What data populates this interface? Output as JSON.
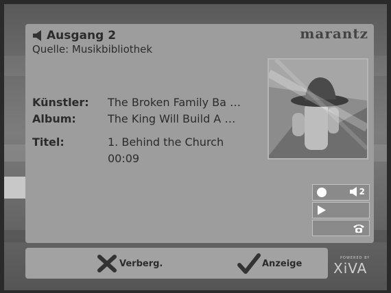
{
  "header": {
    "output_title": "Ausgang 2",
    "source_line": "Quelle: Musikbibliothek",
    "brand": "marantz"
  },
  "track": {
    "artist_label": "Künstler:",
    "artist_value": "The Broken Family Ba …",
    "album_label": "Album:",
    "album_value": "The King Will Build A …",
    "title_label": "Titel:",
    "title_value": "1. Behind the Church",
    "elapsed": "00:09"
  },
  "controls": {
    "volume_zone": "2",
    "icons": [
      "record-icon",
      "speaker-icon",
      "play-icon",
      "telephone-icon"
    ]
  },
  "bottom": {
    "hide_label": "Verberg.",
    "show_label": "Anzeige"
  },
  "footer_logo": {
    "powered_by": "POWERED BY",
    "name": "XiVA"
  },
  "colors": {
    "panel": "#9d9d9d",
    "text": "#2b2b2b",
    "controls_bg": "#8a8a8a",
    "icon_white": "#ffffff"
  }
}
